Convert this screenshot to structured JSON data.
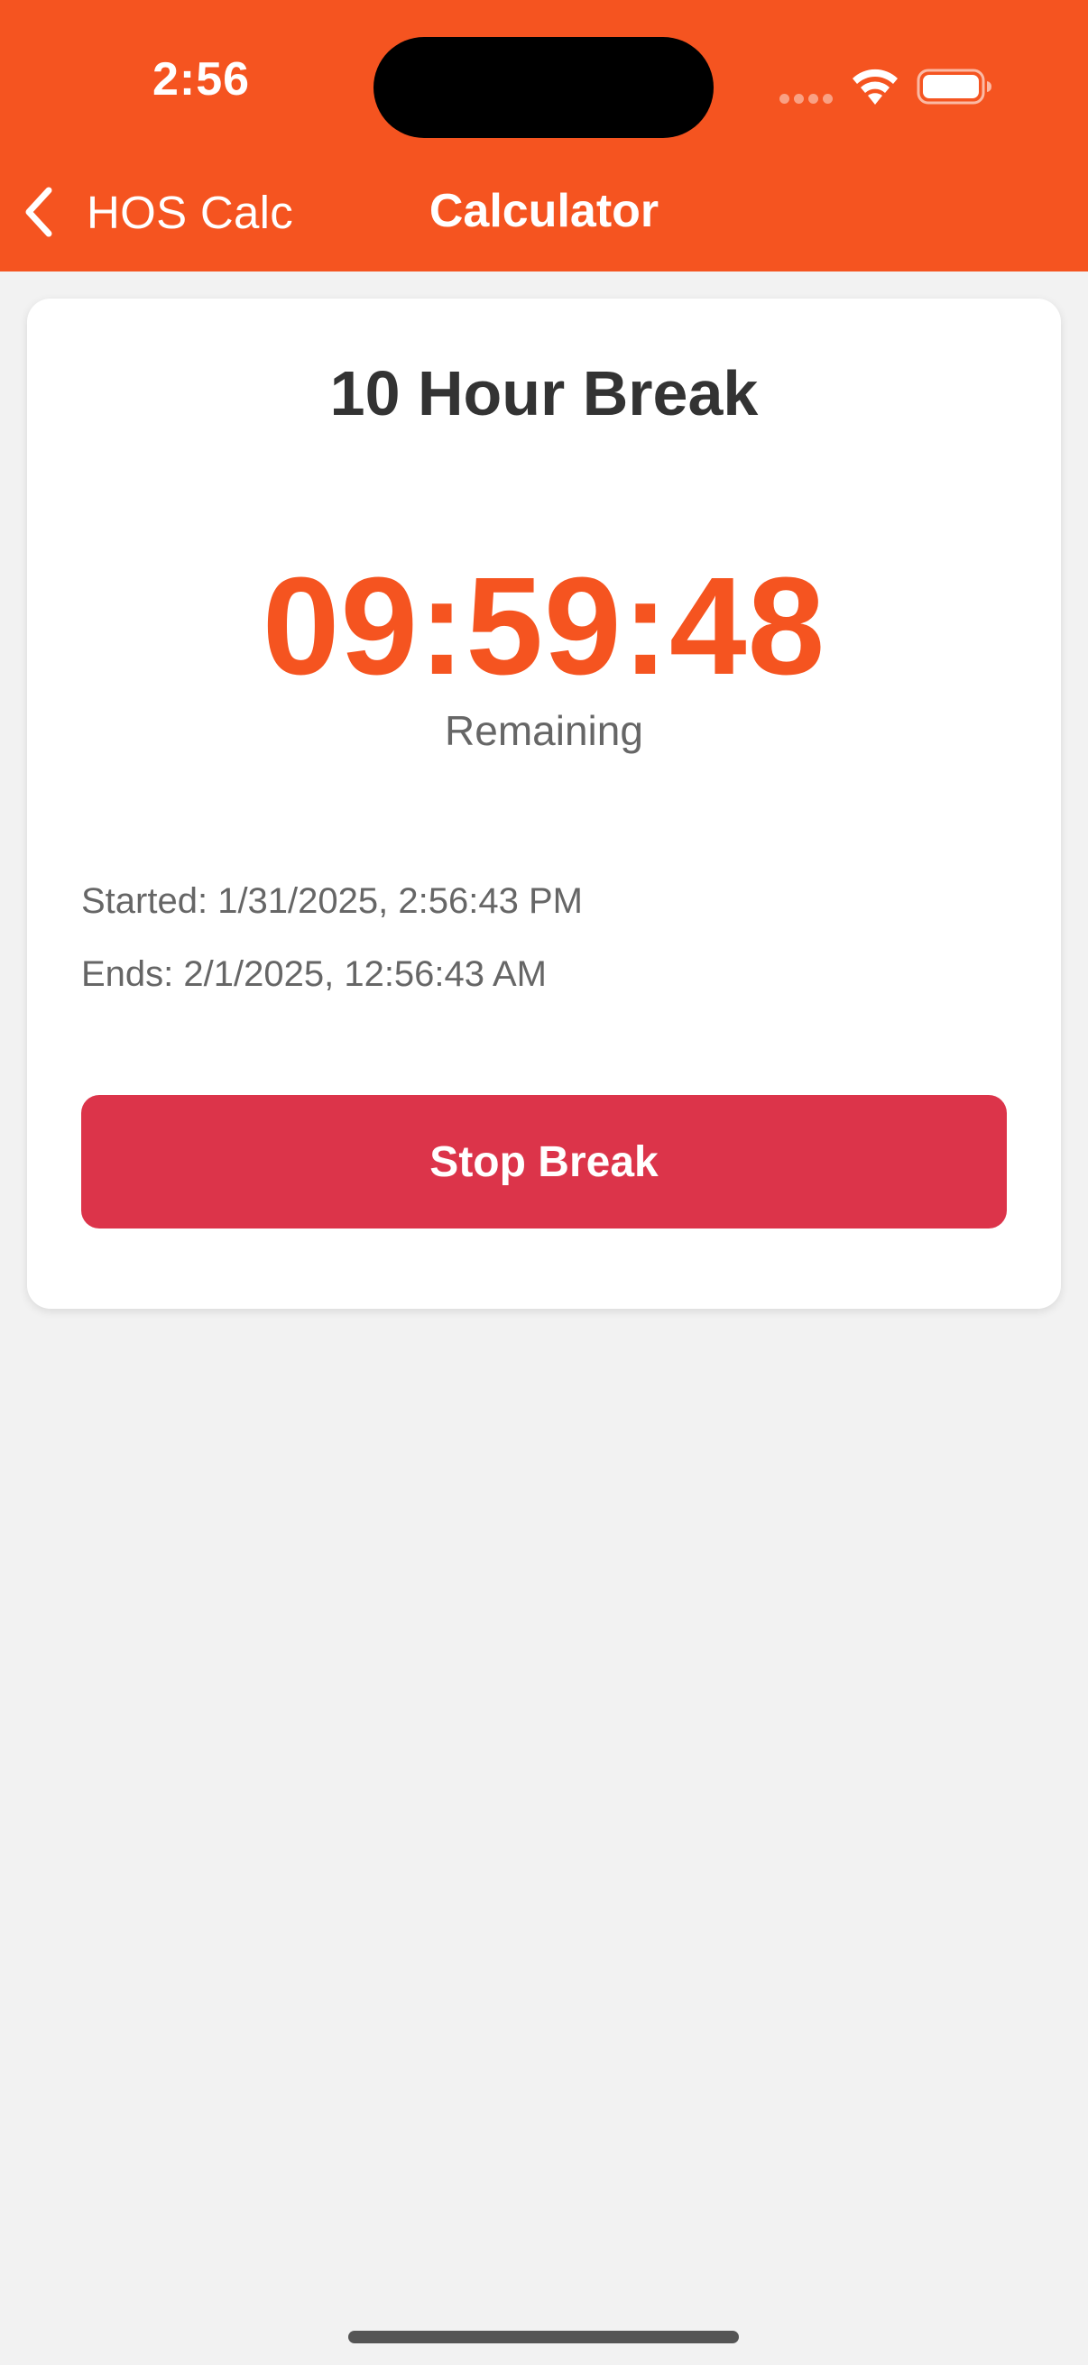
{
  "status_bar": {
    "time": "2:56",
    "icons": [
      "signal-dots-icon",
      "wifi-icon",
      "battery-icon"
    ]
  },
  "nav": {
    "back_label": "HOS Calc",
    "back_icon": "chevron-left-icon",
    "title": "Calculator"
  },
  "card": {
    "title": "10 Hour Break",
    "countdown": "09:59:48",
    "remaining_label": "Remaining",
    "started": "Started: 1/31/2025, 2:56:43 PM",
    "ends": "Ends: 2/1/2025, 12:56:43 AM",
    "stop_button_label": "Stop Break"
  },
  "colors": {
    "accent": "#f55420",
    "danger": "#dc344a",
    "background": "#f2f2f2"
  }
}
